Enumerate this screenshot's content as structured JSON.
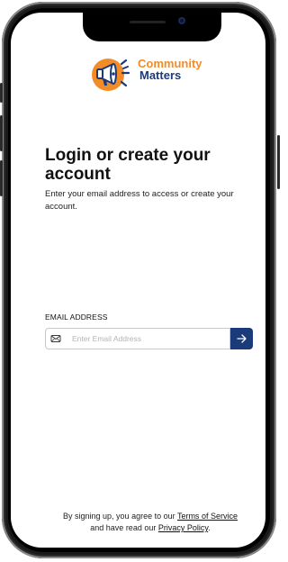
{
  "brand": {
    "name_line1": "Community",
    "name_line2": "Matters",
    "orange": "#F28C28",
    "navy": "#1B3A7A",
    "logo_icon": "megaphone-icon"
  },
  "login": {
    "title": "Login or create your account",
    "subtitle": "Enter your email address to access or create your account."
  },
  "email": {
    "label": "EMAIL ADDRESS",
    "placeholder": "Enter Email Address",
    "value": "",
    "field_icon": "mail-icon",
    "submit_icon": "arrow-right-icon"
  },
  "footer": {
    "line1_prefix": "By signing up, you agree to our ",
    "terms_link": "Terms of Service",
    "line2_prefix": "and have read our ",
    "privacy_link": "Privacy Policy",
    "line2_suffix": "."
  }
}
